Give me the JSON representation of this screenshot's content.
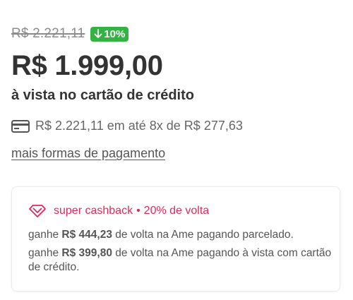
{
  "pricing": {
    "old_price": "R$ 2.221,11",
    "discount": "10%",
    "price": "R$ 1.999,00",
    "cash_label": "à vista no cartão de crédito",
    "installments": "R$ 2.221,11 em até 8x de R$ 277,63",
    "more_payment": "mais formas de pagamento"
  },
  "cashback": {
    "title": "super cashback",
    "separator": "•",
    "percent": "20% de volta",
    "line1": {
      "prefix": "ganhe ",
      "amount": "R$ 444,23",
      "suffix": " de volta na Ame pagando parcelado."
    },
    "line2": {
      "prefix": "ganhe ",
      "amount": "R$ 399,80",
      "suffix": " de volta na Ame pagando à vista com cartão de crédito."
    }
  },
  "icons": {
    "discount_arrow": "arrow-down-icon",
    "installments": "credit-card-icon",
    "cashback": "diamond-icon"
  },
  "colors": {
    "badge_green": "#34b344",
    "cashback_pink": "#e0295a",
    "text_dark": "#333333"
  }
}
